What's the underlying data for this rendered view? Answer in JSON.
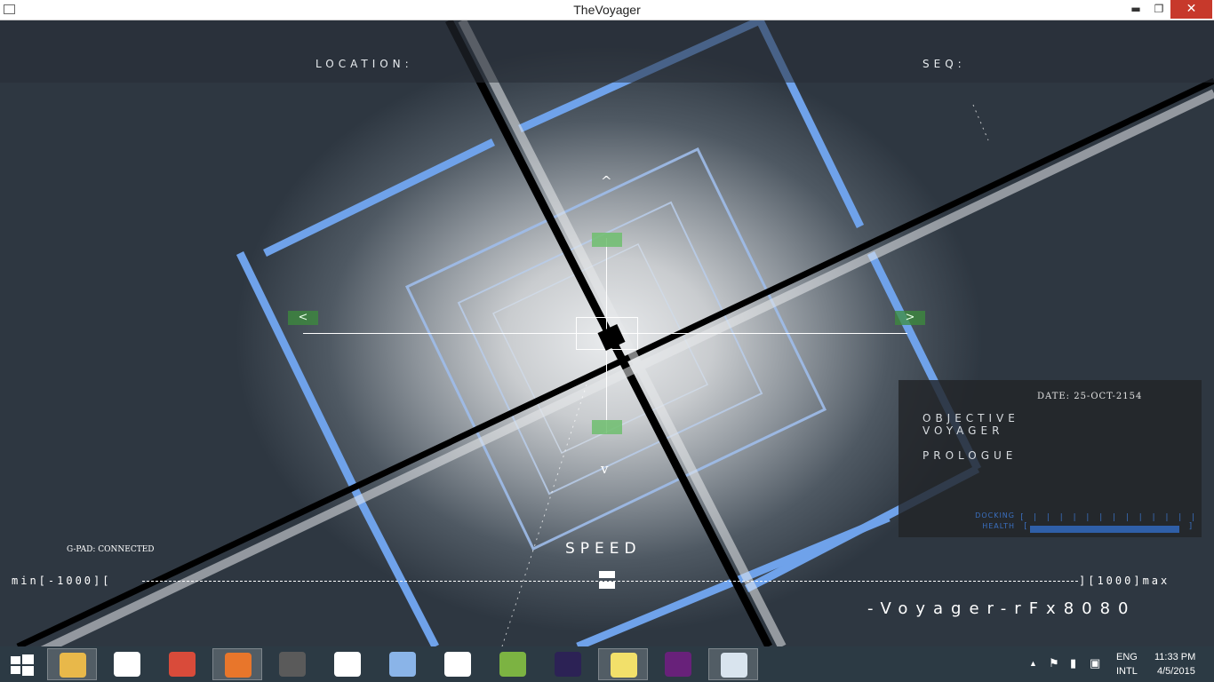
{
  "window": {
    "title": "TheVoyager",
    "controls": {
      "minimize": "▬",
      "maximize": "❐",
      "close": "✕"
    }
  },
  "hud": {
    "location_label": "LOCATION:",
    "seq_label": "SEQ:",
    "nav": {
      "up": "^",
      "down": "v",
      "left": "<",
      "right": ">"
    },
    "gpad_status": "G-PAD: CONNECTED",
    "speed": {
      "label": "SPEED",
      "min_text": "min[-1000][",
      "max_text": "][1000]max",
      "current_fraction": 0.5
    },
    "brand": "-Voyager-rFx8080"
  },
  "info_panel": {
    "date": "DATE: 25-OCT-2154",
    "objective_line1": "OBJECTIVE",
    "objective_line2": "VOYAGER",
    "chapter": "PROLOGUE",
    "docking_label": "DOCKING",
    "health_label": "HEALTH",
    "docking_ticks": "[ | | | | | | | | | | | | | | | ]",
    "health_fraction": 1.0
  },
  "taskbar": {
    "apps": [
      {
        "name": "file-explorer-icon",
        "color": "#e8b84a",
        "active": true
      },
      {
        "name": "hp-icon",
        "color": "#ffffff",
        "active": false
      },
      {
        "name": "chrome-icon",
        "color": "#d94b3a",
        "active": false
      },
      {
        "name": "firefox-icon",
        "color": "#e8762b",
        "active": true
      },
      {
        "name": "sublime-icon",
        "color": "#5a5a5a",
        "active": false
      },
      {
        "name": "apps-grid-icon",
        "color": "#ffffff",
        "active": false
      },
      {
        "name": "paint-icon",
        "color": "#8ab4e8",
        "active": false
      },
      {
        "name": "unity-icon",
        "color": "#ffffff",
        "active": false
      },
      {
        "name": "android-studio-icon",
        "color": "#7cb342",
        "active": false
      },
      {
        "name": "eclipse-icon",
        "color": "#2c2255",
        "active": false
      },
      {
        "name": "sticky-notes-icon",
        "color": "#f2e06a",
        "active": true
      },
      {
        "name": "visual-studio-icon",
        "color": "#68217a",
        "active": false
      },
      {
        "name": "voyager-window-icon",
        "color": "#d9e4ee",
        "active": true
      }
    ],
    "tray": {
      "lang_top": "ENG",
      "lang_bottom": "INTL",
      "time": "11:33 PM",
      "date": "4/5/2015",
      "show_hidden": "▲",
      "flag_icon": "⚑",
      "power_icon": "▮",
      "network_icon": "▣"
    }
  }
}
